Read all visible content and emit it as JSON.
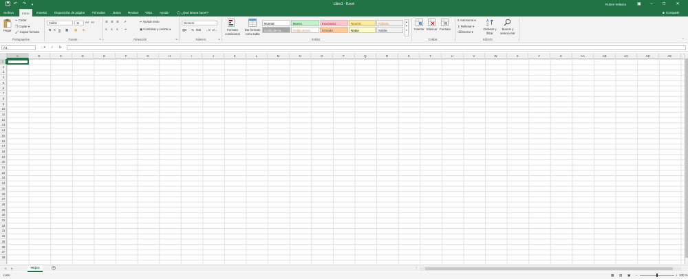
{
  "titlebar": {
    "title": "Libro1  -  Excel",
    "user": "Ruben Velasco",
    "minimize": "–",
    "restore": "❐",
    "close": "✕",
    "ribbon_options": "▣"
  },
  "tabs": [
    "Archivo",
    "Inicio",
    "Insertar",
    "Disposición de página",
    "Fórmulas",
    "Datos",
    "Revisar",
    "Vista",
    "Ayuda"
  ],
  "tell_me": "¿Qué desea hacer?",
  "share": "Compartir",
  "clipboard": {
    "paste": "Pegar",
    "cut": "Cortar",
    "copy": "Copiar",
    "format_painter": "Copiar formato",
    "label": "Portapapeles"
  },
  "font": {
    "name": "Calibri",
    "size": "11",
    "bold": "N",
    "italic": "K",
    "underline": "S",
    "label": "Fuente"
  },
  "alignment": {
    "wrap": "Ajustar texto",
    "merge": "Combinar y centrar",
    "label": "Alineación"
  },
  "number": {
    "format": "General",
    "label": "Número"
  },
  "styles": {
    "conditional": "Formato condicional",
    "as_table": "Dar formato como tabla",
    "label": "Estilos",
    "cells": [
      {
        "text": "Normal",
        "bg": "#ffffff",
        "fg": "#000000"
      },
      {
        "text": "Bueno",
        "bg": "#c6efce",
        "fg": "#006100"
      },
      {
        "text": "Incorrecto",
        "bg": "#ffc7ce",
        "fg": "#9c0006"
      },
      {
        "text": "Neutral",
        "bg": "#ffeb9c",
        "fg": "#9c5700"
      },
      {
        "text": "Cálculo",
        "bg": "#f2f2f2",
        "fg": "#fa7d00"
      },
      {
        "text": "Celda de co...",
        "bg": "#a5a5a5",
        "fg": "#ffffff"
      },
      {
        "text": "Celda vincul...",
        "bg": "#ffffff",
        "fg": "#fa7d00"
      },
      {
        "text": "Entrada",
        "bg": "#ffcc99",
        "fg": "#3f3f76"
      },
      {
        "text": "Notas",
        "bg": "#ffffcc",
        "fg": "#000000"
      },
      {
        "text": "Salida",
        "bg": "#f2f2f2",
        "fg": "#3f3f3f"
      }
    ]
  },
  "cells_group": {
    "insert": "Insertar",
    "delete": "Eliminar",
    "format": "Formato",
    "label": "Celdas"
  },
  "editing": {
    "autosum": "Autosuma",
    "fill": "Rellenar",
    "clear": "Borrar",
    "sort": "Ordenar y filtrar",
    "find": "Buscar y seleccionar",
    "label": "Edición"
  },
  "formula_bar": {
    "namebox": "A1",
    "fx": "fx",
    "cancel": "✕",
    "enter": "✓"
  },
  "columns": [
    "A",
    "B",
    "C",
    "D",
    "E",
    "F",
    "G",
    "H",
    "I",
    "J",
    "K",
    "L",
    "M",
    "N",
    "O",
    "P",
    "Q",
    "R",
    "S",
    "T",
    "U",
    "V",
    "W",
    "X",
    "Y",
    "Z",
    "AA",
    "AB",
    "AC",
    "AD",
    "AE"
  ],
  "rows": [
    "1",
    "2",
    "3",
    "4",
    "5",
    "6",
    "7",
    "8",
    "9",
    "10",
    "11",
    "12",
    "13",
    "14",
    "15",
    "16",
    "17",
    "18",
    "19",
    "20",
    "21",
    "22",
    "23",
    "24",
    "25",
    "26",
    "27",
    "28",
    "29",
    "30",
    "31",
    "32",
    "33",
    "34",
    "35",
    "36",
    "37",
    "38"
  ],
  "sheet": {
    "name": "Hoja1",
    "add": "+"
  },
  "status": {
    "ready": "Listo",
    "zoom": "100 %",
    "zoom_minus": "–",
    "zoom_plus": "+"
  },
  "colors": {
    "excel_green": "#217346",
    "ribbon_bg": "#f3f3f3"
  }
}
